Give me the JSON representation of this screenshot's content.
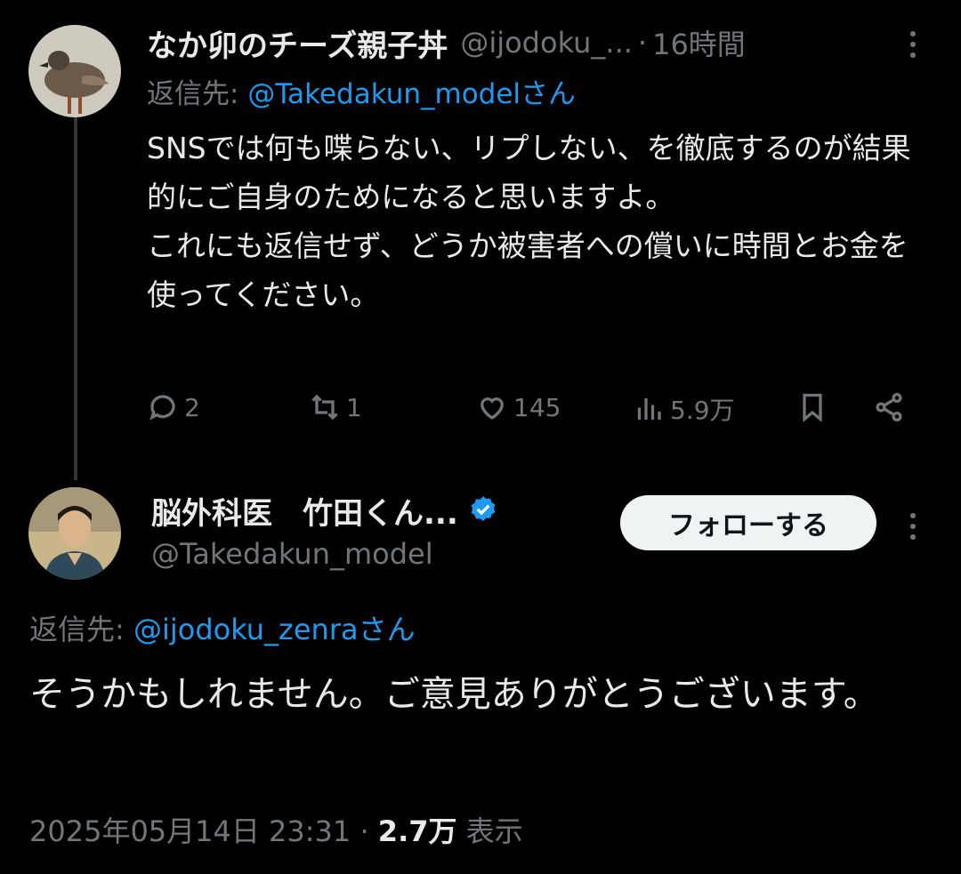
{
  "reply_tweet": {
    "author_name": "なか卯のチーズ親子丼",
    "author_handle": "@ijodoku_...",
    "time_separator": "·",
    "time": "16時間",
    "reply_label": "返信先:",
    "reply_mention": "@Takedakun_model",
    "reply_suffix": "さん",
    "text": "SNSでは何も喋らない、リプしない、を徹底するのが結果的にご自身のためになると思いますよ。\nこれにも返信せず、どうか被害者への償いに時間とお金を使ってください。",
    "actions": {
      "replies": "2",
      "reposts": "1",
      "likes": "145",
      "views": "5.9万"
    }
  },
  "main_tweet": {
    "author_name": "脳外科医　竹田くん...",
    "author_handle": "@Takedakun_model",
    "follow_label": "フォローする",
    "reply_label": "返信先:",
    "reply_mention": "@ijodoku_zenra",
    "reply_suffix": "さん",
    "text": "そうかもしれません。ご意見ありがとうございます。",
    "timestamp": "2025年05月14日 23:31",
    "separator": "·",
    "view_count": "2.7万",
    "view_label": "表示"
  },
  "icons": {
    "reply": "reply-icon",
    "repost": "repost-icon",
    "like": "heart-icon",
    "views": "views-icon",
    "bookmark": "bookmark-icon",
    "share": "share-icon",
    "more": "more-icon",
    "verified": "verified-badge-icon"
  },
  "colors": {
    "background": "#000000",
    "text": "#e7e9ea",
    "muted": "#71767b",
    "accent": "#1d9bf0"
  }
}
